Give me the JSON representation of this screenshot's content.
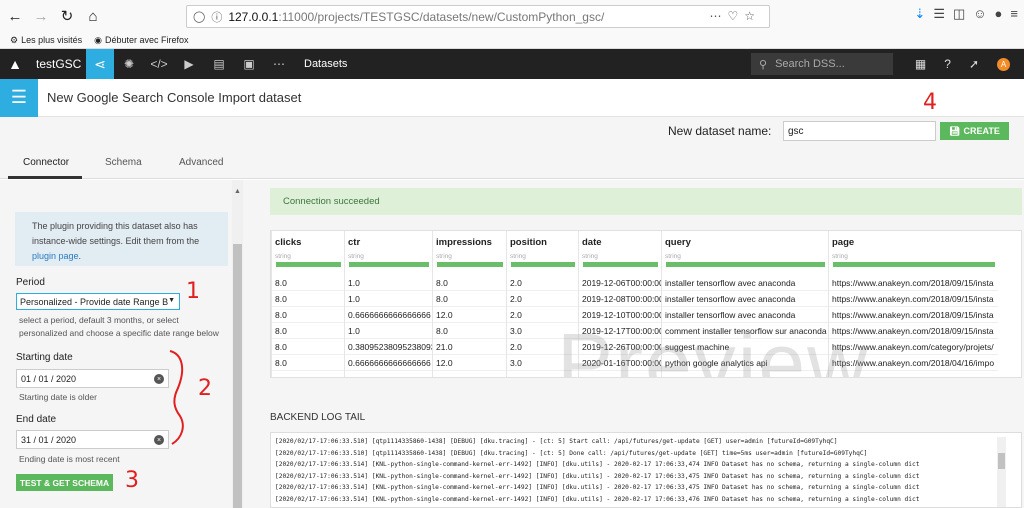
{
  "browser": {
    "url_host": "127.0.0.1",
    "url_path": ":11000/projects/TESTGSC/datasets/new/CustomPython_gsc/",
    "bookmarks": [
      "Les plus visités",
      "Débuter avec Firefox"
    ]
  },
  "dss_nav": {
    "project_name": "testGSC",
    "current_section": "Datasets",
    "search_placeholder": "Search DSS...",
    "avatar_letter": "A"
  },
  "page": {
    "title": "New Google Search Console Import dataset",
    "name_label": "New dataset name:",
    "name_value": "gsc",
    "create_label": "CREATE"
  },
  "tabs": [
    "Connector",
    "Schema",
    "Advanced"
  ],
  "connector": {
    "info_line1": "The plugin providing this dataset also has",
    "info_line2": "instance-wide settings. Edit them from the",
    "info_link": "plugin page",
    "info_end": ".",
    "period_label": "Period",
    "period_value": "Personalized - Provide date Range B",
    "period_help1": "select a period, default 3 months, or select",
    "period_help2": "personalized and choose a specific date range below",
    "start_label": "Starting date",
    "start_value": "01 / 01 / 2020",
    "start_help": "Starting date is older",
    "end_label": "End date",
    "end_value": "31 / 01 / 2020",
    "end_help": "Ending date is most recent",
    "test_label": "TEST & GET SCHEMA"
  },
  "annotations": [
    "1",
    "2",
    "3",
    "4"
  ],
  "preview": {
    "success_msg": "Connection succeeded",
    "watermark": "Preview",
    "columns": [
      {
        "name": "clicks",
        "type": "string"
      },
      {
        "name": "ctr",
        "type": "string"
      },
      {
        "name": "impressions",
        "type": "string"
      },
      {
        "name": "position",
        "type": "string"
      },
      {
        "name": "date",
        "type": "string"
      },
      {
        "name": "query",
        "type": "string"
      },
      {
        "name": "page",
        "type": "string"
      }
    ],
    "rows": [
      [
        "8.0",
        "1.0",
        "8.0",
        "2.0",
        "2019-12-06T00:00:00",
        "installer tensorflow avec anaconda",
        "https://www.anakeyn.com/2018/09/15/insta"
      ],
      [
        "8.0",
        "1.0",
        "8.0",
        "2.0",
        "2019-12-08T00:00:00",
        "installer tensorflow avec anaconda",
        "https://www.anakeyn.com/2018/09/15/insta"
      ],
      [
        "8.0",
        "0.6666666666666666",
        "12.0",
        "2.0",
        "2019-12-10T00:00:00",
        "installer tensorflow avec anaconda",
        "https://www.anakeyn.com/2018/09/15/insta"
      ],
      [
        "8.0",
        "1.0",
        "8.0",
        "3.0",
        "2019-12-17T00:00:00",
        "comment installer tensorflow sur anaconda",
        "https://www.anakeyn.com/2018/09/15/insta"
      ],
      [
        "8.0",
        "0.38095238095238093",
        "21.0",
        "2.0",
        "2019-12-26T00:00:00",
        "suggest machine",
        "https://www.anakeyn.com/category/projets/"
      ],
      [
        "8.0",
        "0.6666666666666666",
        "12.0",
        "3.0",
        "2020-01-16T00:00:00",
        "python google analytics api",
        "https://www.anakeyn.com/2018/04/16/impo"
      ]
    ]
  },
  "log": {
    "title": "BACKEND LOG TAIL",
    "lines": [
      "[2020/02/17-17:06:33.510] [qtp1114335860-1438] [DEBUG] [dku.tracing]  - [ct: 5] Start call: /api/futures/get-update [GET] user=admin [futureId=G09TyhqC]",
      "[2020/02/17-17:06:33.510] [qtp1114335860-1438] [DEBUG] [dku.tracing]  - [ct: 5] Done call: /api/futures/get-update [GET] time=5ms user=admin [futureId=G09TyhqC]",
      "[2020/02/17-17:06:33.514] [KNL-python-single-command-kernel-err-1492] [INFO] [dku.utils]  - 2020-02-17 17:06:33,474 INFO Dataset has no schema, returning a single-column dict",
      "[2020/02/17-17:06:33.514] [KNL-python-single-command-kernel-err-1492] [INFO] [dku.utils]  - 2020-02-17 17:06:33,475 INFO Dataset has no schema, returning a single-column dict",
      "[2020/02/17-17:06:33.514] [KNL-python-single-command-kernel-err-1492] [INFO] [dku.utils]  - 2020-02-17 17:06:33,475 INFO Dataset has no schema, returning a single-column dict",
      "[2020/02/17-17:06:33.514] [KNL-python-single-command-kernel-err-1492] [INFO] [dku.utils]  - 2020-02-17 17:06:33,476 INFO Dataset has no schema, returning a single-column dict"
    ]
  }
}
